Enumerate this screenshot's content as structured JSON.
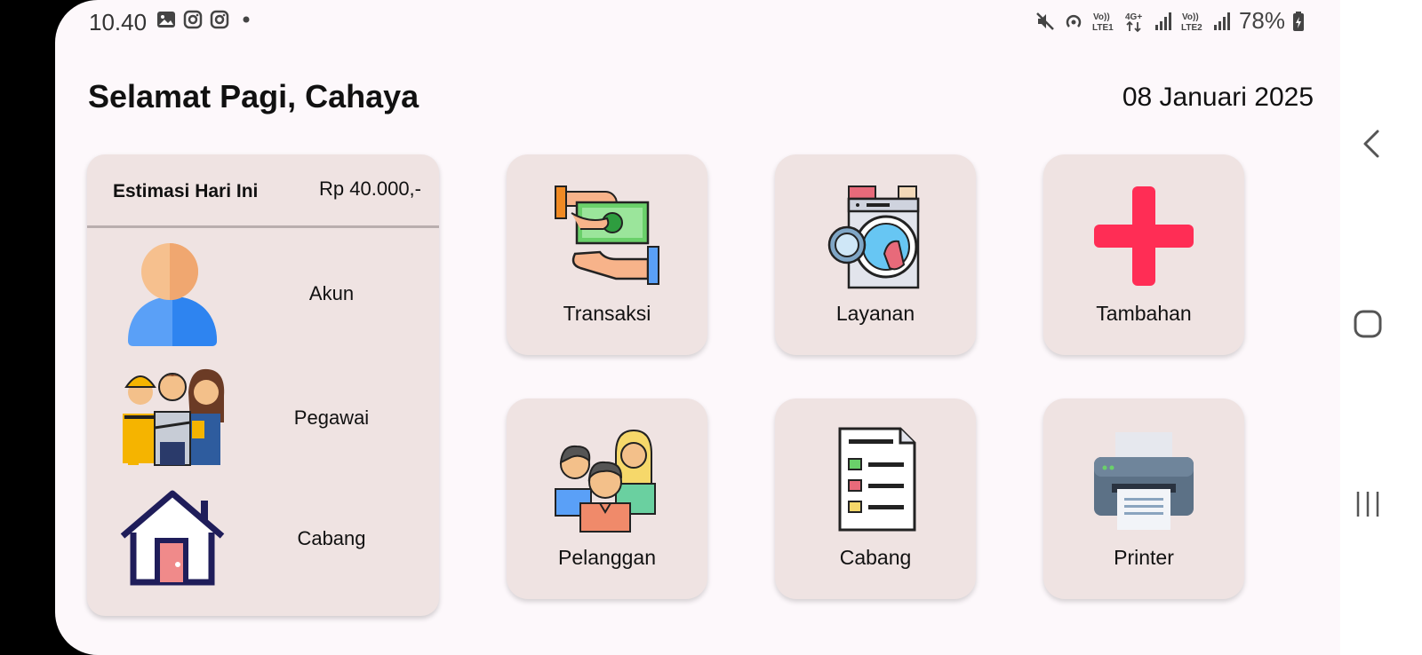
{
  "status_bar": {
    "time": "10.40",
    "battery": "78%",
    "left_icons": [
      "gallery-icon",
      "instagram-icon",
      "instagram-icon",
      "dot-icon"
    ],
    "right_icons": [
      "mute-icon",
      "hotspot-icon",
      "volte1-icon",
      "4g-icon",
      "signal1-icon",
      "volte2-icon",
      "signal2-icon",
      "battery-icon"
    ]
  },
  "header": {
    "greeting": "Selamat Pagi, Cahaya",
    "date": "08 Januari 2025"
  },
  "estimate": {
    "label": "Estimasi Hari Ini",
    "value": "Rp 40.000,-"
  },
  "left_menu": [
    {
      "label": "Akun",
      "icon": "user-icon"
    },
    {
      "label": "Pegawai",
      "icon": "employees-icon"
    },
    {
      "label": "Cabang",
      "icon": "house-icon"
    }
  ],
  "tiles": [
    {
      "label": "Transaksi",
      "icon": "money-transfer-icon"
    },
    {
      "label": "Layanan",
      "icon": "washing-machine-icon"
    },
    {
      "label": "Tambahan",
      "icon": "plus-icon"
    },
    {
      "label": "Pelanggan",
      "icon": "customers-icon"
    },
    {
      "label": "Cabang",
      "icon": "checklist-icon"
    },
    {
      "label": "Printer",
      "icon": "printer-icon"
    }
  ],
  "colors": {
    "background": "#fdf8fb",
    "card": "#efe3e2",
    "accent_red": "#ff2d55"
  },
  "system_nav": [
    "back-icon",
    "home-icon",
    "recents-icon"
  ]
}
